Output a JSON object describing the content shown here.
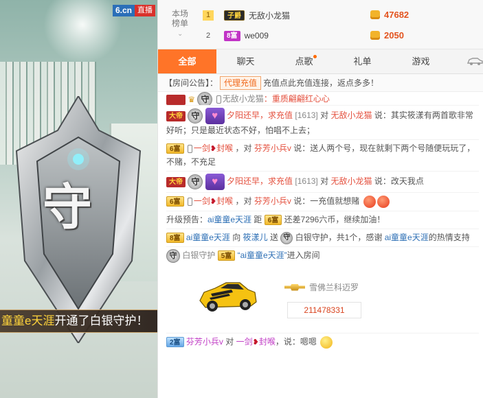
{
  "brand": {
    "logo": "6.cn",
    "live": "直播"
  },
  "video": {
    "badge_glyph": "守",
    "banner": {
      "highlight": "童童e天涯",
      "text": "开通了白银守护！"
    }
  },
  "ranking": {
    "title": "本场榜单",
    "rows": [
      {
        "rank": "1",
        "level": "子爵",
        "name": "无敌小龙猫",
        "coins": "47682"
      },
      {
        "rank": "2",
        "level": "8富",
        "name": "we009",
        "coins": "2050"
      }
    ]
  },
  "tabs": [
    "全部",
    "聊天",
    "点歌",
    "礼单",
    "游戏"
  ],
  "notice": {
    "prefix": "【房间公告】：",
    "button": "代理充值",
    "text": "充值点此充值连接，返点多多！"
  },
  "chat": {
    "m0": {
      "user": "无敌小龙猫",
      "tail": "：重质翩翩红心心"
    },
    "m1": {
      "level": "大帝",
      "user": "夕阳还早，求充值",
      "id": "[1613]",
      "mid": "对",
      "target": "无敌小龙猫",
      "say": "说：",
      "text": "其实筱漾有两首歌非常好听；只是最近状态不好，怕唱不上去；"
    },
    "m2": {
      "level": "6富",
      "user": "一剑",
      "mid": "封喉",
      "to": "，对",
      "target": "芬芳小兵v",
      "say": "说：",
      "text": "送人两个号，现在就剩下两个号随便玩玩了，不赌，不充足"
    },
    "m3": {
      "level": "大帝",
      "user": "夕阳还早，求充值",
      "id": "[1613]",
      "mid": "对",
      "target": "无敌小龙猫",
      "say": "说：",
      "text": "改天我点"
    },
    "m4": {
      "level": "6富",
      "user": "一剑",
      "mid": "封喉",
      "to": "，对",
      "target": "芬芳小兵v",
      "say": "说：",
      "text": "一充值就想赌"
    },
    "m5": {
      "text1": "升级预告：",
      "user": "ai童童e天涯",
      "text2": "距",
      "level": "6富",
      "text3": "还差7296六币，继续加油！"
    },
    "m6": {
      "level": "8富",
      "user": "ai童童e天涯",
      "mid": "向",
      "target": "筱漾儿",
      "text1": "送",
      "gift": "白银守护，共1个，感谢",
      "user2": "ai童童e天涯",
      "text2": "的热情支持"
    },
    "m7": {
      "prefix": "白银守护",
      "level": "5富",
      "user": "“ai童童e天涯”",
      "text": "进入房间"
    },
    "gift": {
      "brand": "雪佛兰科迈罗",
      "number": "211478331"
    },
    "m8": {
      "level": "2富",
      "user": "芬芳小兵v",
      "mid": "对",
      "target": "一剑",
      "target2": "封喉",
      "say": "，说：",
      "text": "嗯嗯"
    }
  }
}
